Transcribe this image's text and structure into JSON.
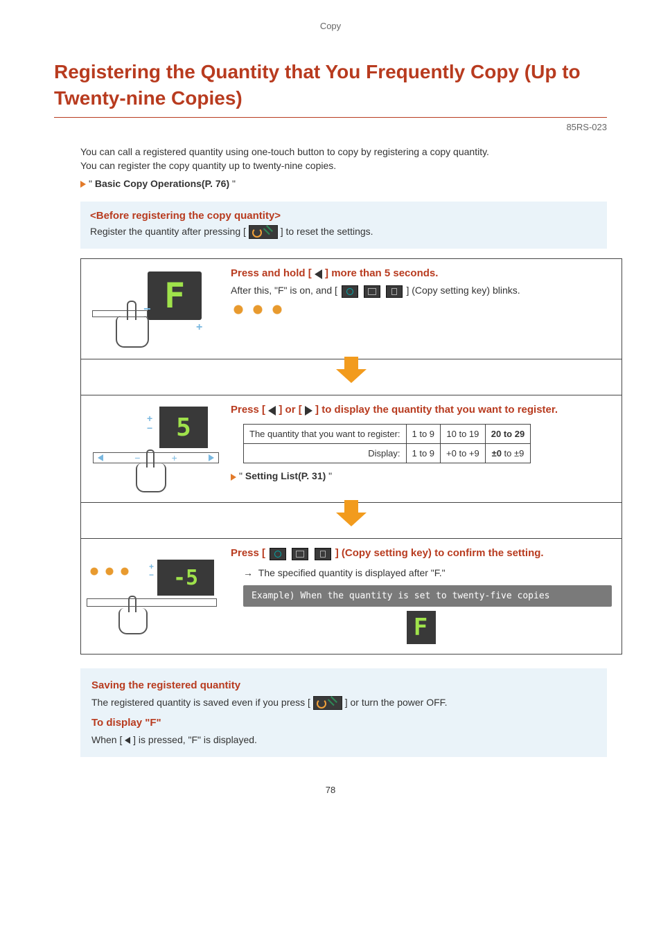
{
  "page": {
    "top_label": "Copy",
    "title": "Registering the Quantity that You Frequently Copy (Up to Twenty-nine Copies)",
    "doc_code": "85RS-023",
    "number": "78"
  },
  "intro": {
    "line1": "You can call a registered quantity using one-touch button to copy by registering a copy quantity.",
    "line2": "You can register the copy quantity up to twenty-nine copies.",
    "link_prefix": "\" ",
    "link_text": "Basic Copy Operations(P. 76)",
    "link_suffix": " \""
  },
  "before_box": {
    "title": "<Before registering the copy quantity>",
    "line_pre": "Register the quantity after pressing [",
    "line_post": "] to reset the settings."
  },
  "step1": {
    "display_char": "F",
    "title_pre": "Press and hold [ ",
    "title_post": " ] more than 5 seconds.",
    "sub_pre": "After this, \"F\" is on, and [",
    "sub_post": "] (Copy setting key) blinks."
  },
  "step2": {
    "display_char": "5",
    "title_pre": "Press [ ",
    "title_mid": " ] or [ ",
    "title_post": " ] to display the quantity that you want to register.",
    "table": {
      "row1_label": "The quantity that you want to register:",
      "row1_c1": "1 to 9",
      "row1_c2": "10 to 19",
      "row1_c3": "20 to 29",
      "row2_label": "Display:",
      "row2_c1": "1 to 9",
      "row2_c2": "+0 to +9",
      "row2_c3": "±0 to ±9"
    },
    "sub_link_prefix": "\" ",
    "sub_link": "Setting List(P. 31)",
    "sub_link_suffix": " \""
  },
  "step3": {
    "display_text": "-5",
    "title_pre": "Press [",
    "title_post": "] (Copy setting key) to confirm the setting.",
    "sub": "The specified quantity is displayed after \"F.\"",
    "example_label": "Example) When the quantity is set to twenty-five copies",
    "example_display": "F"
  },
  "bottom": {
    "title1": "Saving the registered quantity",
    "line1_pre": "The registered quantity is saved even if you press [",
    "line1_post": "] or turn the power OFF.",
    "title2": "To display \"F\"",
    "line2_pre": "When [ ",
    "line2_post": " ] is pressed, \"F\" is displayed."
  }
}
